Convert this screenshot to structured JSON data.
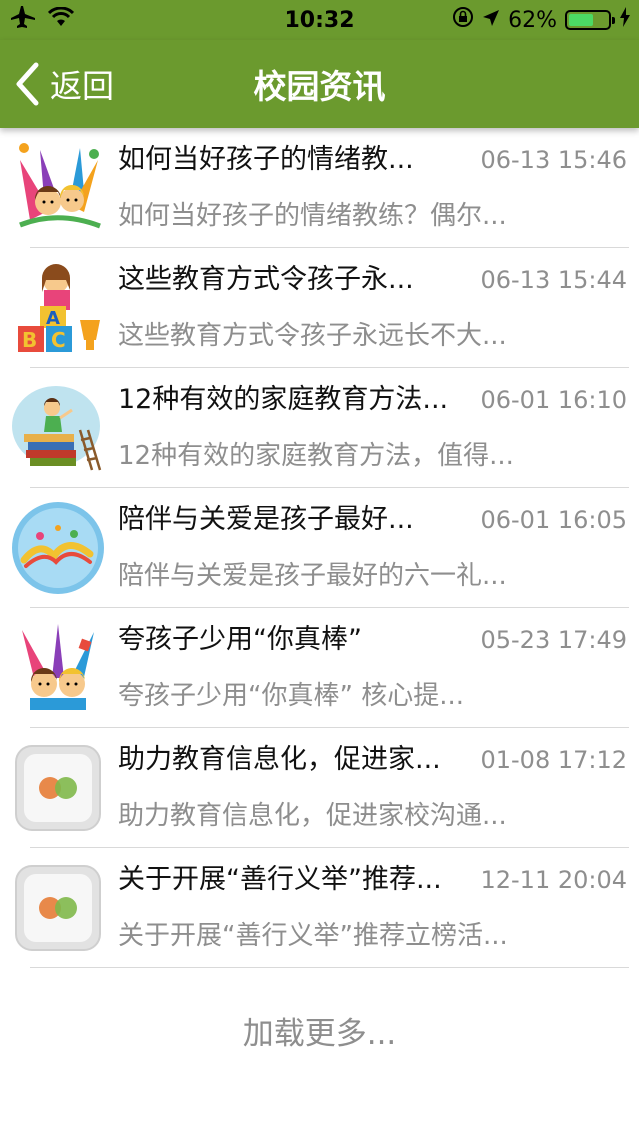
{
  "status_bar": {
    "time": "10:32",
    "battery": "62%",
    "battery_level": 0.62,
    "icons": [
      "airplane-icon",
      "wifi-icon",
      "lock-rotation-icon",
      "location-icon",
      "battery-icon",
      "charging-icon"
    ]
  },
  "nav": {
    "back_label": "返回",
    "title": "校园资讯"
  },
  "articles": [
    {
      "title": "如何当好孩子的情绪教...",
      "time": "06-13 15:46",
      "summary": "如何当好孩子的情绪教练？偶尔...",
      "thumb": "kids-celebration-image"
    },
    {
      "title": "这些教育方式令孩子永...",
      "time": "06-13 15:44",
      "summary": "这些教育方式令孩子永远长不大...",
      "thumb": "abc-blocks-girl-image"
    },
    {
      "title": "12种有效的家庭教育方法...",
      "time": "06-01 16:10",
      "summary": "12种有效的家庭教育方法，值得...",
      "thumb": "girl-on-books-image"
    },
    {
      "title": "陪伴与关爱是孩子最好...",
      "time": "06-01 16:05",
      "summary": "陪伴与关爱是孩子最好的六一礼...",
      "thumb": "childrens-day-badge-image"
    },
    {
      "title": "夸孩子少用“你真棒”",
      "time": "05-23 17:49",
      "summary": "夸孩子少用“你真棒”      核心提...",
      "thumb": "kids-party-image"
    },
    {
      "title": "助力教育信息化，促进家...",
      "time": "01-08 17:12",
      "summary": "助力教育信息化，促进家校沟通...",
      "thumb": "app-logo-placeholder"
    },
    {
      "title": "关于开展“善行义举”推荐...",
      "time": "12-11 20:04",
      "summary": "关于开展“善行义举”推荐立榜活...",
      "thumb": "app-logo-placeholder"
    }
  ],
  "load_more": "加载更多...",
  "colors": {
    "nav_green": "#6b9a2e",
    "meta_gray": "#8e8e8e",
    "separator": "#d9d9d9"
  }
}
